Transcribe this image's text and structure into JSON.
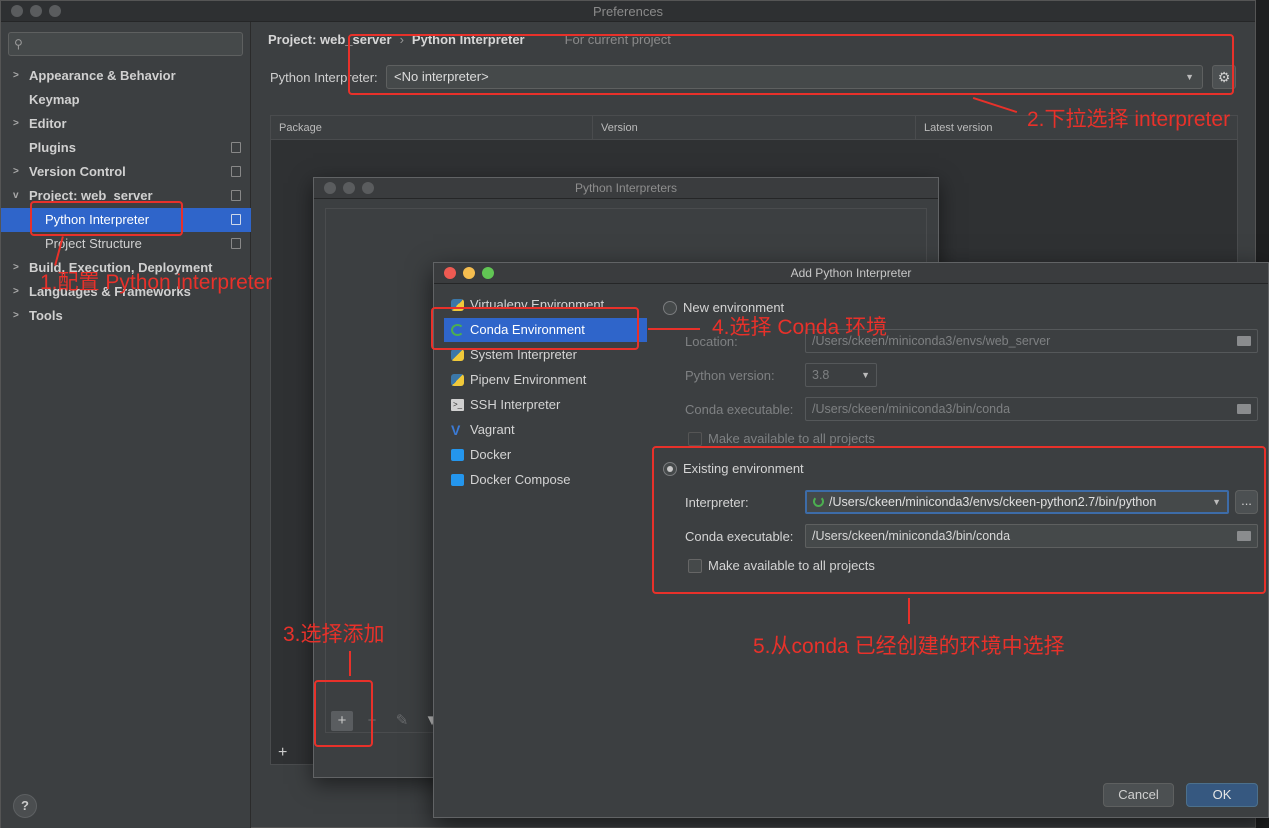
{
  "window": {
    "title": "Preferences"
  },
  "sidebar": {
    "search_placeholder": "",
    "items": [
      {
        "label": "Appearance & Behavior"
      },
      {
        "label": "Keymap"
      },
      {
        "label": "Editor"
      },
      {
        "label": "Plugins"
      },
      {
        "label": "Version Control"
      },
      {
        "label": "Project: web_server"
      },
      {
        "label": "Python Interpreter"
      },
      {
        "label": "Project Structure"
      },
      {
        "label": "Build, Execution, Deployment"
      },
      {
        "label": "Languages & Frameworks"
      },
      {
        "label": "Tools"
      }
    ],
    "help": "?"
  },
  "main": {
    "breadcrumb": {
      "project": "Project: web_server",
      "sep": "›",
      "page": "Python Interpreter",
      "hint": "For current project"
    },
    "interpreter_label": "Python Interpreter:",
    "interpreter_value": "<No interpreter>",
    "table": {
      "columns": [
        "Package",
        "Version",
        "Latest version"
      ]
    },
    "add": "+"
  },
  "interpreters_dialog": {
    "title": "Python Interpreters"
  },
  "add_dialog": {
    "title": "Add Python Interpreter",
    "env_types": [
      {
        "label": "Virtualenv Environment",
        "icon": "python-icon"
      },
      {
        "label": "Conda Environment",
        "icon": "conda-icon"
      },
      {
        "label": "System Interpreter",
        "icon": "python-icon"
      },
      {
        "label": "Pipenv Environment",
        "icon": "python-icon"
      },
      {
        "label": "SSH Interpreter",
        "icon": "ssh-icon"
      },
      {
        "label": "Vagrant",
        "icon": "vagrant-icon"
      },
      {
        "label": "Docker",
        "icon": "docker-icon"
      },
      {
        "label": "Docker Compose",
        "icon": "docker-icon"
      }
    ],
    "new_env": {
      "label": "New environment",
      "location_label": "Location:",
      "location_value": "/Users/ckeen/miniconda3/envs/web_server",
      "python_version_label": "Python version:",
      "python_version_value": "3.8",
      "conda_exec_label": "Conda executable:",
      "conda_exec_value": "/Users/ckeen/miniconda3/bin/conda",
      "make_available_label": "Make available to all projects"
    },
    "existing_env": {
      "label": "Existing environment",
      "interpreter_label": "Interpreter:",
      "interpreter_value": "/Users/ckeen/miniconda3/envs/ckeen-python2.7/bin/python",
      "browse": "...",
      "conda_exec_label": "Conda executable:",
      "conda_exec_value": "/Users/ckeen/miniconda3/bin/conda",
      "make_available_label": "Make available to all projects"
    },
    "cancel": "Cancel",
    "ok": "OK"
  },
  "annotations": {
    "step1": "1.配置 Python interpreter",
    "step2": "2.下拉选择 interpreter",
    "step3": "3.选择添加",
    "step4": "4.选择 Conda 环境",
    "step5": "5.从conda 已经创建的环境中选择"
  },
  "colors": {
    "accent_selected": "#2f65ca",
    "annotation": "#e8312a",
    "ok_button": "#365880"
  }
}
